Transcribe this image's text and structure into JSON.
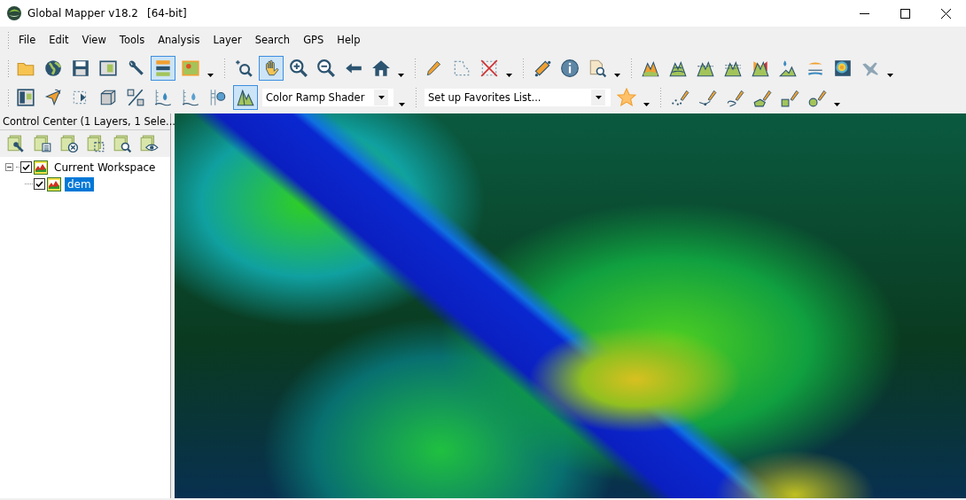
{
  "window": {
    "title": "Global Mapper v18.2",
    "subtitle": "[64-bit]"
  },
  "menu": [
    "File",
    "Edit",
    "View",
    "Tools",
    "Analysis",
    "Layer",
    "Search",
    "GPS",
    "Help"
  ],
  "toolbars": [
    {
      "items": [
        {
          "kind": "button",
          "selected": false
        },
        {
          "kind": "button",
          "selected": false
        },
        {
          "kind": "button",
          "selected": false
        },
        {
          "kind": "button",
          "selected": false
        },
        {
          "kind": "button",
          "selected": false
        },
        {
          "kind": "button",
          "selected": true
        },
        {
          "kind": "button",
          "selected": false
        },
        {
          "kind": "caret"
        },
        {
          "kind": "separator"
        },
        {
          "kind": "button",
          "selected": false
        },
        {
          "kind": "button",
          "selected": true
        },
        {
          "kind": "button",
          "selected": false
        },
        {
          "kind": "button",
          "selected": false
        },
        {
          "kind": "button",
          "selected": false
        },
        {
          "kind": "button",
          "selected": false
        },
        {
          "kind": "caret"
        },
        {
          "kind": "separator"
        },
        {
          "kind": "button",
          "selected": false
        },
        {
          "kind": "button",
          "selected": false
        },
        {
          "kind": "button",
          "selected": false
        },
        {
          "kind": "caret"
        },
        {
          "kind": "separator"
        },
        {
          "kind": "button",
          "selected": false
        },
        {
          "kind": "button",
          "selected": false
        },
        {
          "kind": "button",
          "selected": false
        },
        {
          "kind": "caret"
        },
        {
          "kind": "separator"
        },
        {
          "kind": "button",
          "selected": false
        },
        {
          "kind": "button",
          "selected": false
        },
        {
          "kind": "button",
          "selected": false
        },
        {
          "kind": "button",
          "selected": false
        },
        {
          "kind": "button",
          "selected": false
        },
        {
          "kind": "button",
          "selected": false
        },
        {
          "kind": "button",
          "selected": false
        },
        {
          "kind": "button",
          "selected": false
        },
        {
          "kind": "button",
          "selected": false
        },
        {
          "kind": "caret"
        }
      ]
    },
    {
      "items": [
        {
          "kind": "button",
          "selected": false
        },
        {
          "kind": "button",
          "selected": false
        },
        {
          "kind": "button",
          "selected": false
        },
        {
          "kind": "button",
          "selected": false
        },
        {
          "kind": "button",
          "selected": false
        },
        {
          "kind": "button",
          "selected": false
        },
        {
          "kind": "button",
          "selected": false
        },
        {
          "kind": "button",
          "selected": false
        },
        {
          "kind": "button",
          "selected": true
        },
        {
          "kind": "combo",
          "value": "Color Ramp Shader"
        },
        {
          "kind": "caret"
        },
        {
          "kind": "separator"
        },
        {
          "kind": "combo",
          "value": "Set up Favorites List..."
        },
        {
          "kind": "button",
          "selected": false
        },
        {
          "kind": "caret"
        },
        {
          "kind": "separator"
        },
        {
          "kind": "button",
          "selected": false
        },
        {
          "kind": "button",
          "selected": false
        },
        {
          "kind": "button",
          "selected": false
        },
        {
          "kind": "button",
          "selected": false
        },
        {
          "kind": "button",
          "selected": false
        },
        {
          "kind": "button",
          "selected": false
        },
        {
          "kind": "caret"
        }
      ]
    }
  ],
  "control_center": {
    "title": "Control Center (1 Layers, 1 Sele...",
    "tree": [
      {
        "label": "Current Workspace",
        "checked": true,
        "expanded": true,
        "selected": false,
        "children": [
          {
            "label": "dem",
            "checked": true,
            "selected": true
          }
        ]
      }
    ]
  }
}
